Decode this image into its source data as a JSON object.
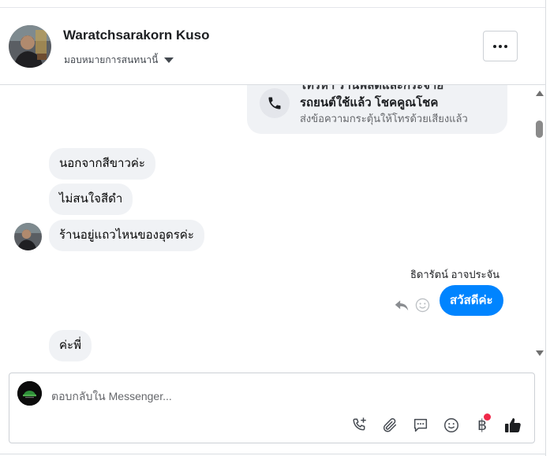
{
  "header": {
    "contact_name": "Waratchsarakorn Kuso",
    "assign_label": "มอบหมายการสนทนานี้",
    "more_label": "..."
  },
  "call_card": {
    "title_cut": "โทรหา ร้านพลดและกระจาย",
    "title": "รถยนต์ใช้แล้ว โชคคูณโชค",
    "subtitle": "ส่งข้อความกระตุ้นให้โทรด้วยเสียงแล้ว"
  },
  "messages": {
    "incoming_1": "นอกจากสีขาวค่ะ",
    "incoming_2": "ไม่สนใจสีดำ",
    "incoming_3": "ร้านอยู่แถวไหนของอุดรค่ะ",
    "sender_name": "ธิดารัตน์ อาจประจัน",
    "outgoing_1": "สวัสดีค่ะ",
    "incoming_4": "ค่ะพี่"
  },
  "composer": {
    "placeholder": "ตอบกลับใน Messenger...",
    "value": "",
    "currency_symbol": "฿"
  },
  "colors": {
    "accent": "#0084ff",
    "bubble_in": "#f0f2f5",
    "notification": "#f02849"
  },
  "icons": [
    "call-add-icon",
    "paperclip-icon",
    "saved-reply-icon",
    "emoji-icon",
    "payment-baht-icon",
    "thumbs-up-icon",
    "reply-icon",
    "reaction-icon",
    "phone-icon",
    "more-icon",
    "chevron-down-icon"
  ]
}
